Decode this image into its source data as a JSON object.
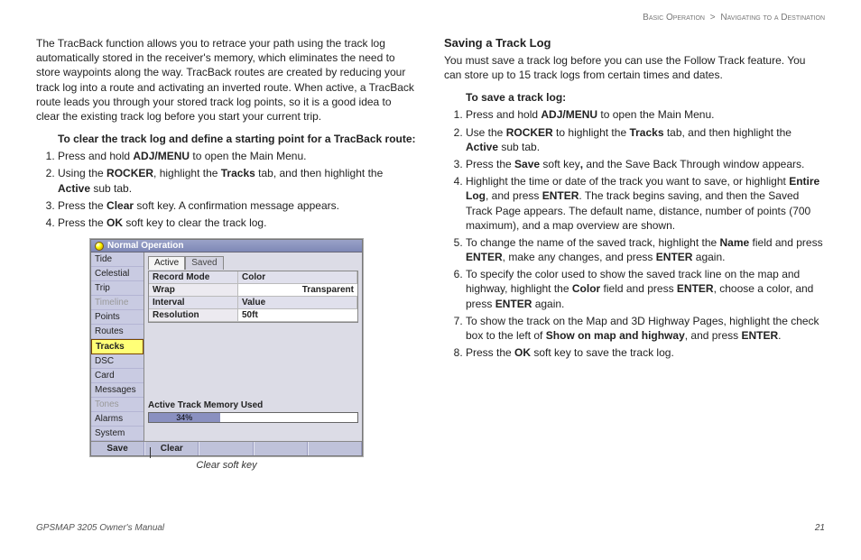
{
  "breadcrumb": {
    "a": "Basic Operation",
    "b": "Navigating to a Destination"
  },
  "left": {
    "intro": "The TracBack function allows you to retrace your path using the track log automatically stored in the receiver's memory, which eliminates the need to store waypoints along the way. TracBack routes are created by reducing your track log into a route and activating an inverted route. When active, a TracBack route leads you through your stored track log points, so it is a good idea to clear the existing track log before you start your current trip.",
    "heading": "To clear the track log and define a starting point for a TracBack route:",
    "steps": [
      "Press and hold ADJ/MENU to open the Main Menu.",
      "Using the ROCKER, highlight the Tracks tab, and then highlight the Active sub tab.",
      "Press the Clear soft key. A confirmation message appears.",
      "Press the OK soft key to clear the track log."
    ]
  },
  "device": {
    "title": "Normal Operation",
    "sidebar": [
      "Tide",
      "Celestial",
      "Trip",
      "Timeline",
      "Points",
      "Routes",
      "Tracks",
      "DSC",
      "Card",
      "Messages",
      "Tones",
      "Alarms",
      "System"
    ],
    "active_index": 6,
    "disabled_indices": [
      3,
      10
    ],
    "tabs": [
      "Active",
      "Saved"
    ],
    "active_tab": 0,
    "rows": [
      {
        "l": "Record Mode",
        "r": "Color",
        "vl": "Wrap",
        "vr": "Transparent"
      },
      {
        "l": "Interval",
        "r": "Value",
        "vl": "Resolution",
        "vr": "50ft"
      }
    ],
    "memory_label": "Active Track Memory Used",
    "memory_pct": "34%",
    "softkeys": [
      "Save",
      "Clear",
      "",
      "",
      ""
    ],
    "caption": "Clear soft key"
  },
  "right": {
    "h": "Saving a Track Log",
    "p": "You must save a track log before you can use the Follow Track feature. You can store up to 15 track logs from certain times and dates.",
    "heading": "To save a track log:",
    "steps": [
      "Press and hold ADJ/MENU to open the Main Menu.",
      "Use the ROCKER to highlight the Tracks tab, and then highlight the Active sub tab.",
      "Press the Save soft key, and the Save Back Through window appears.",
      "Highlight the time or date of the track you want to save, or highlight Entire Log, and press ENTER. The track begins saving, and then the Saved Track Page appears. The default name, distance, number of points (700 maximum), and a map overview are shown.",
      "To change the name of the saved track, highlight the Name field and press ENTER, make any changes, and press ENTER again.",
      "To specify the color used to show the saved track line on the map and highway, highlight the Color field and press ENTER, choose a color, and press ENTER again.",
      "To show the track on the Map and 3D Highway Pages, highlight the check box to the left of Show on map and highway, and press ENTER.",
      "Press the OK soft key to save the track log."
    ]
  },
  "footer": {
    "left": "GPSMAP 3205 Owner's Manual",
    "right": "21"
  }
}
